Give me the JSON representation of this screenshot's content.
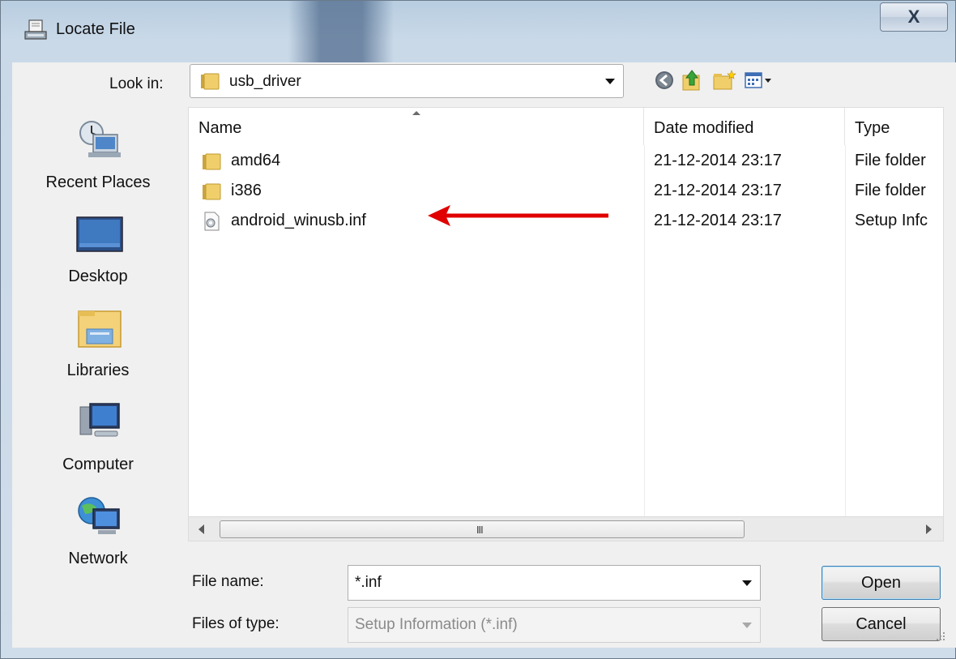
{
  "window": {
    "title": "Locate File",
    "close_label": "X"
  },
  "look_in": {
    "label": "Look in:",
    "value": "usb_driver"
  },
  "toolbar": {
    "back_icon": "back-arrow-icon",
    "up_icon": "up-folder-icon",
    "new_folder_icon": "new-folder-icon",
    "view_icon": "view-menu-icon"
  },
  "places": [
    {
      "label": "Recent Places",
      "icon": "recent-places-icon"
    },
    {
      "label": "Desktop",
      "icon": "desktop-icon"
    },
    {
      "label": "Libraries",
      "icon": "libraries-icon"
    },
    {
      "label": "Computer",
      "icon": "computer-icon"
    },
    {
      "label": "Network",
      "icon": "network-icon"
    }
  ],
  "list": {
    "columns": [
      "Name",
      "Date modified",
      "Type"
    ],
    "rows": [
      {
        "name": "amd64",
        "date": "21-12-2014 23:17",
        "type": "File folder",
        "icon": "folder-icon"
      },
      {
        "name": "i386",
        "date": "21-12-2014 23:17",
        "type": "File folder",
        "icon": "folder-icon"
      },
      {
        "name": "android_winusb.inf",
        "date": "21-12-2014 23:17",
        "type": "Setup Infc",
        "icon": "setup-file-icon"
      }
    ],
    "scroll_grip": "III"
  },
  "file_name": {
    "label": "File name:",
    "value": "*.inf"
  },
  "file_type": {
    "label": "Files of type:",
    "value": "Setup Information (*.inf)"
  },
  "buttons": {
    "open": "Open",
    "cancel": "Cancel"
  },
  "colors": {
    "annotation_arrow": "#e00000",
    "folder": "#e8c35a"
  }
}
